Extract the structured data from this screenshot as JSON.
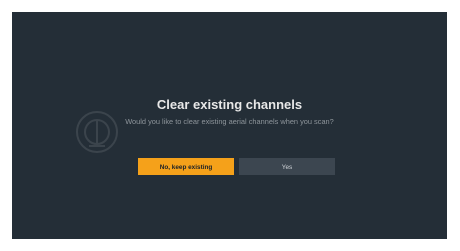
{
  "dialog": {
    "title": "Clear existing channels",
    "message": "Would you like to clear existing aerial channels when you scan?"
  },
  "buttons": {
    "keep_label": "No, keep existing",
    "yes_label": "Yes"
  },
  "colors": {
    "background": "#242e37",
    "accent": "#f5a11a",
    "secondary_button": "#3c4650"
  },
  "icons": {
    "background_watermark": "aerial-antenna-icon"
  }
}
